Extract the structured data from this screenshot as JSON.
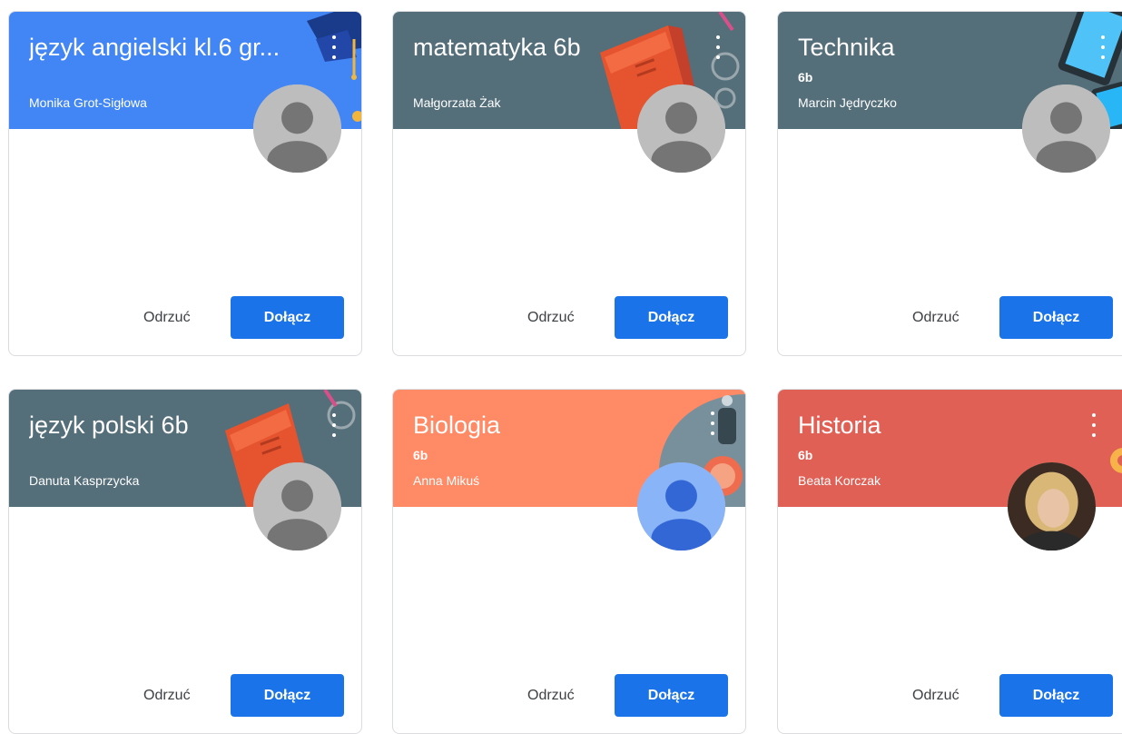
{
  "cards": [
    {
      "title": "język angielski kl.6 gr...",
      "section": "",
      "teacher": "Monika Grot-Sigłowa",
      "header_color": "#4285f4",
      "avatar": "default-gray",
      "reject_label": "Odrzuć",
      "join_label": "Dołącz"
    },
    {
      "title": "matematyka 6b",
      "section": "",
      "teacher": "Małgorzata Żak",
      "header_color": "#546e7a",
      "avatar": "default-gray",
      "reject_label": "Odrzuć",
      "join_label": "Dołącz"
    },
    {
      "title": "Technika",
      "section": "6b",
      "teacher": "Marcin Jędryczko",
      "header_color": "#546e7a",
      "avatar": "default-gray",
      "reject_label": "Odrzuć",
      "join_label": "Dołącz"
    },
    {
      "title": "język polski 6b",
      "section": "",
      "teacher": "Danuta Kasprzycka",
      "header_color": "#546e7a",
      "avatar": "default-gray",
      "reject_label": "Odrzuć",
      "join_label": "Dołącz"
    },
    {
      "title": "Biologia",
      "section": "6b",
      "teacher": "Anna Mikuś",
      "header_color": "#ff8a65",
      "avatar": "default-blue",
      "reject_label": "Odrzuć",
      "join_label": "Dołącz"
    },
    {
      "title": "Historia",
      "section": "6b",
      "teacher": "Beata Korczak",
      "header_color": "#e06055",
      "avatar": "photo",
      "reject_label": "Odrzuć",
      "join_label": "Dołącz"
    }
  ],
  "colors": {
    "join_button": "#1a73e8",
    "card_border": "#dadce0"
  },
  "icons": {
    "menu": "more-vert-icon",
    "avatar": "person-icon"
  }
}
